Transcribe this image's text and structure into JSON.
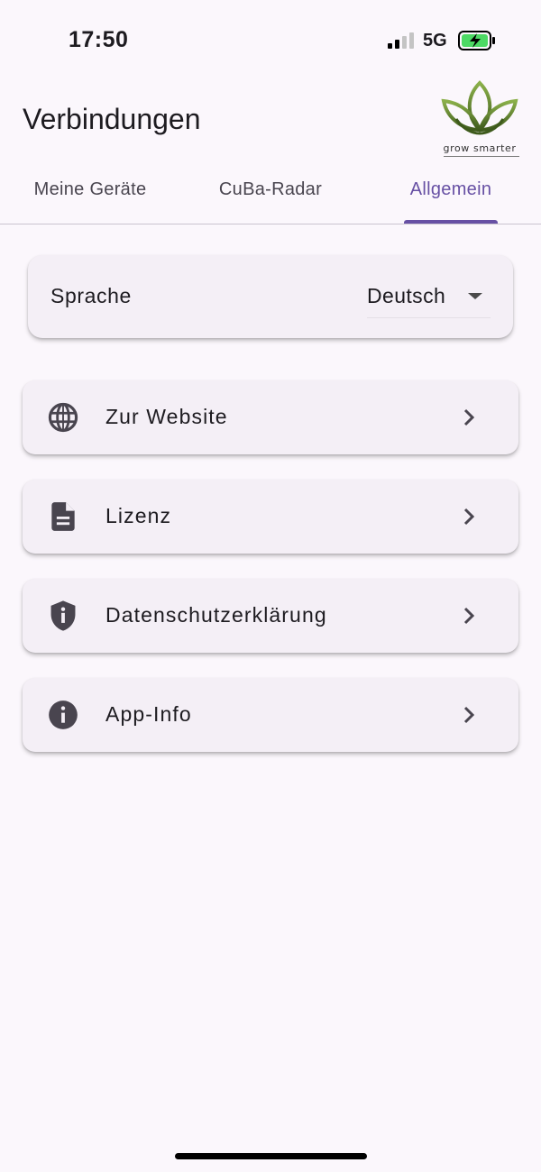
{
  "status": {
    "time": "17:50",
    "network": "5G"
  },
  "header": {
    "title": "Verbindungen",
    "logo_text": "grow smarter"
  },
  "tabs": [
    {
      "label": "Meine Geräte",
      "active": false
    },
    {
      "label": "CuBa-Radar",
      "active": false
    },
    {
      "label": "Allgemein",
      "active": true
    }
  ],
  "settings": {
    "language_label": "Sprache",
    "language_value": "Deutsch"
  },
  "menu": [
    {
      "label": "Zur Website",
      "icon": "globe-icon"
    },
    {
      "label": "Lizenz",
      "icon": "document-icon"
    },
    {
      "label": "Datenschutzerklärung",
      "icon": "shield-info-icon"
    },
    {
      "label": "App-Info",
      "icon": "info-icon"
    }
  ],
  "colors": {
    "accent": "#6750a4",
    "background": "#fbf7fc",
    "card": "#f4eff6",
    "battery": "#4cd964",
    "logo_green": "#6b8f2a"
  }
}
